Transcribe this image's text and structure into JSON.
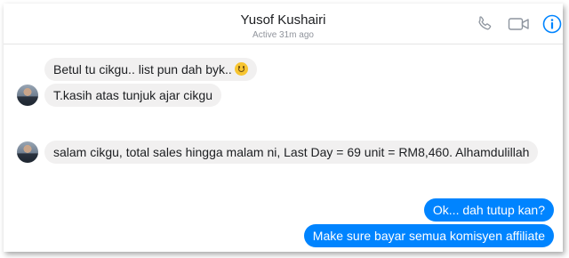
{
  "header": {
    "contact_name": "Yusof Kushairi",
    "status": "Active 31m ago",
    "icons": [
      "phone-icon",
      "video-call-icon",
      "info-icon"
    ],
    "accent_color": "#0084ff"
  },
  "messages": [
    {
      "direction": "incoming",
      "text": "Betul tu cikgu.. list pun dah byk..",
      "emoji": "smiling-face-emoji"
    },
    {
      "direction": "incoming",
      "text": "T.kasih atas tunjuk ajar cikgu"
    },
    {
      "direction": "incoming",
      "text": "salam cikgu, total sales hingga malam ni, Last Day = 69 unit = RM8,460. Alhamdulillah"
    },
    {
      "direction": "outgoing",
      "text": "Ok... dah tutup kan?"
    },
    {
      "direction": "outgoing",
      "text": "Make sure bayar semua komisyen affiliate"
    }
  ]
}
